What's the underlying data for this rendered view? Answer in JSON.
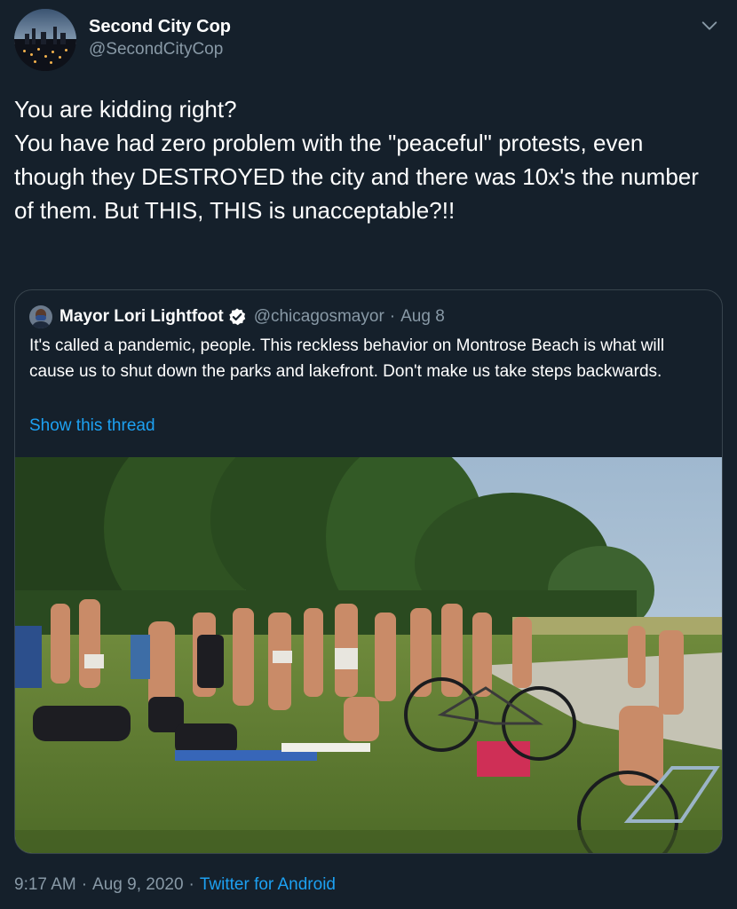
{
  "author": {
    "display_name": "Second City Cop",
    "handle": "@SecondCityCop",
    "avatar_icon": "chicago-skyline-night-avatar"
  },
  "menu_icon": "chevron-down-icon",
  "tweet_text": [
    "You are kidding right?",
    "You have had zero problem with the \"peaceful\" protests, even though they DESTROYED  the city and there was 10x's the number of them. But THIS, THIS is unacceptable?!!"
  ],
  "quoted": {
    "display_name": "Mayor Lori Lightfoot",
    "verified_icon": "verified-badge-icon",
    "handle": "@chicagosmayor",
    "date_sep": "·",
    "date": "Aug 8",
    "text": "It's called a pandemic, people. This reckless behavior on Montrose Beach is what will cause us to shut down the parks and lakefront. Don't make us take steps backwards.",
    "show_thread": "Show this thread",
    "photo": "crowded beach park with people in swimwear, trees, bicycles"
  },
  "footer": {
    "time": "9:17 AM",
    "sep": "·",
    "date": "Aug 9, 2020",
    "sep2": "·",
    "source": "Twitter for Android"
  },
  "colors": {
    "background": "#15202b",
    "border": "#38444d",
    "muted": "#8899a6",
    "link": "#1da1f2"
  }
}
